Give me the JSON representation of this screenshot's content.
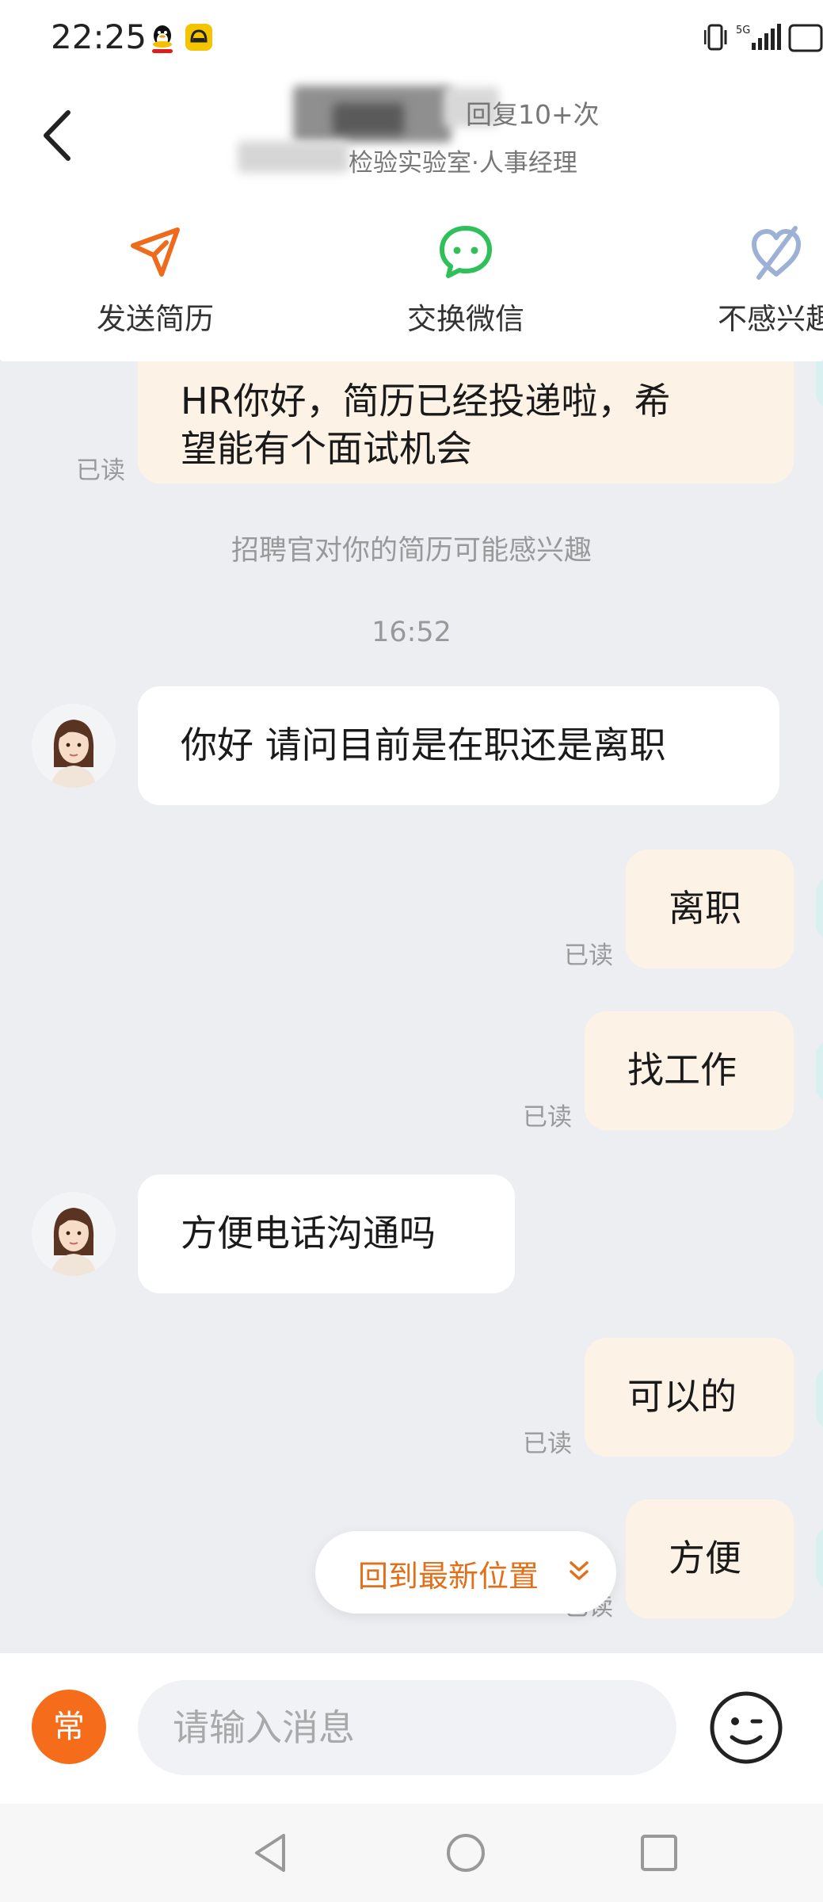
{
  "status_bar": {
    "time": "22:25",
    "icons": [
      "qq-icon",
      "app-notification-icon",
      "vibrate-icon",
      "5g-signal-icon",
      "battery-icon"
    ]
  },
  "header": {
    "reply_stat": "回复10+次",
    "company": "检验实验室·人事经理"
  },
  "actions": [
    {
      "label": "发送简历",
      "icon": "send-resume-icon",
      "color": "#f06a1c"
    },
    {
      "label": "交换微信",
      "icon": "wechat-icon",
      "color": "#2fc05a"
    },
    {
      "label": "不感兴趣",
      "icon": "not-interested-icon",
      "color": "#9db0d6"
    }
  ],
  "chat": {
    "first_message_visible": "HR你好，简历已经投递啦，希望能有个面试机会",
    "first_message_line1": "HR你好，简历已经投递啦，希",
    "first_message_line2": "望能有个面试机会",
    "read_label": "已读",
    "system_notice": "招聘官对你的简历可能感兴趣",
    "timestamp": "16:52",
    "messages": [
      {
        "from": "them",
        "text": "你好 请问目前是在职还是离职"
      },
      {
        "from": "me",
        "text": "离职",
        "status": "已读"
      },
      {
        "from": "me",
        "text": "找工作",
        "status": "已读"
      },
      {
        "from": "them",
        "text": "方便电话沟通吗"
      },
      {
        "from": "me",
        "text": "可以的",
        "status": "已读"
      },
      {
        "from": "me",
        "text": "方便",
        "status": "已读"
      }
    ],
    "jump_to_latest": "回到最新位置"
  },
  "input_bar": {
    "quick_reply_label": "常",
    "placeholder": "请输入消息"
  },
  "colors": {
    "accent": "#f06a1c",
    "my_bubble": "#fdf2e6",
    "their_bubble": "#ffffff",
    "chat_background": "#eceef2"
  }
}
